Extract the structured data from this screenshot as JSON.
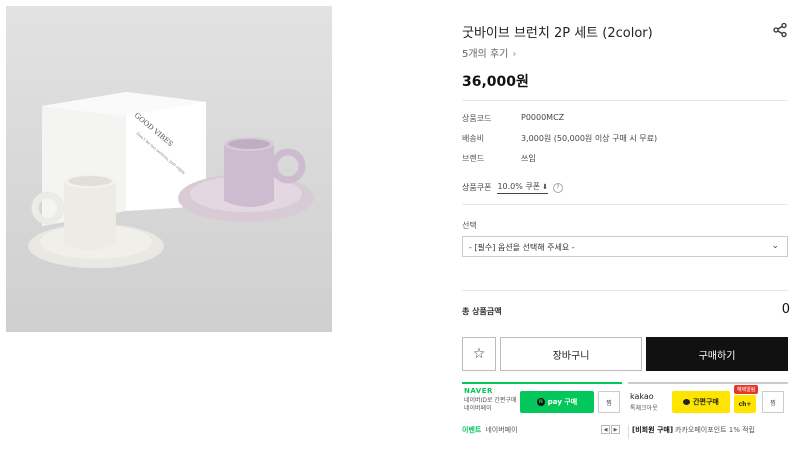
{
  "product": {
    "title": "굿바이브 브런치 2P 세트 (2color)",
    "reviews": "5개의 후기",
    "price": "36,000원",
    "box_text_big": "GOOD VIBES",
    "box_text_small": "Don't be too serious, just enjoy"
  },
  "details": [
    {
      "label": "상품코드",
      "value": "P0000MCZ"
    },
    {
      "label": "배송비",
      "value": "3,000원 (50,000원 이상 구매 시 무료)"
    },
    {
      "label": "브랜드",
      "value": "쓰임"
    }
  ],
  "coupon": {
    "label": "상품쿠폰",
    "link": "10.0% 쿠폰",
    "help": "?"
  },
  "option": {
    "label": "선택",
    "placeholder": "- [필수] 옵션을 선택해 주세요 -"
  },
  "total": {
    "label": "총 상품금액",
    "value": "0"
  },
  "actions": {
    "cart": "장바구니",
    "buy": "구매하기"
  },
  "naver": {
    "logo": "NAVER",
    "desc_line1": "네이버ID로 간편구매",
    "desc_line2": "네이버페이",
    "pay_label": "pay 구매",
    "n_mark": "N",
    "wish": "찜"
  },
  "kakao": {
    "logo": "kakao",
    "sub": "톡체크아웃",
    "pay_label": "간편구매",
    "badge": "혜택알림",
    "ch": "ch+",
    "wish": "찜"
  },
  "promo": {
    "left_tag": "이벤트",
    "left_text": "네이버페이",
    "right_tag": "[비회원 구매]",
    "right_text": "카카오페이포인트 1% 적립"
  },
  "colors": {
    "naver_green": "#03c75a",
    "kakao_yellow": "#fee500",
    "buy_black": "#111111",
    "badge_red": "#e4382d"
  },
  "icons": {
    "share": "share-icon",
    "star": "star-icon",
    "chevron": "chevron-right-icon",
    "caret": "chevron-down-icon"
  }
}
